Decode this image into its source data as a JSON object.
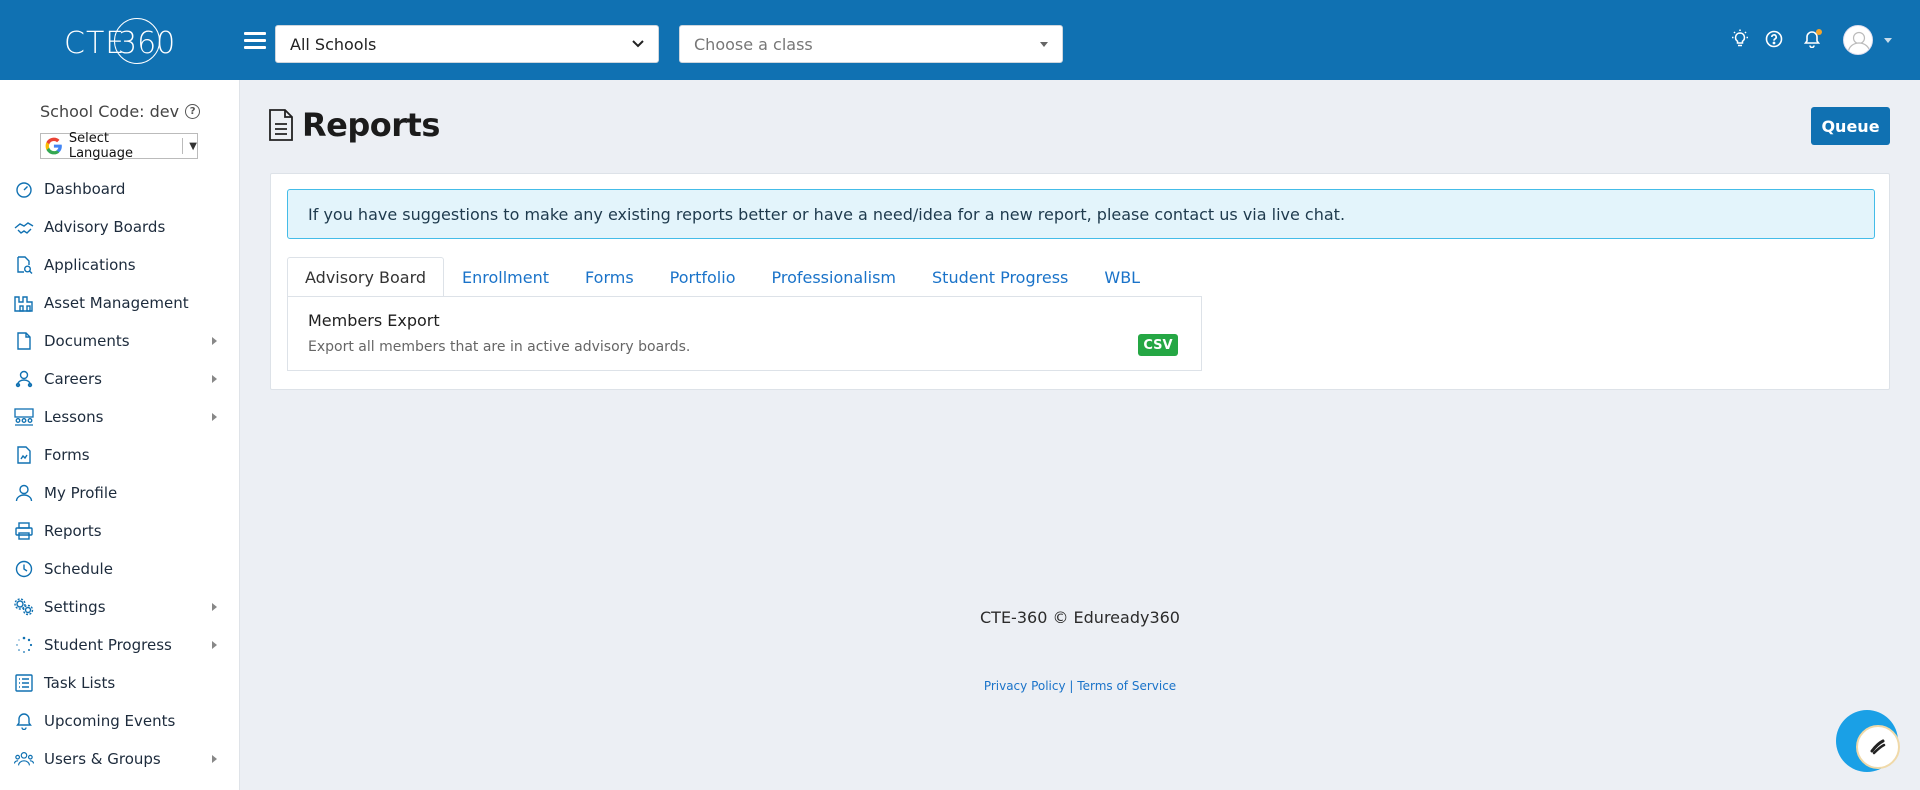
{
  "header": {
    "logo_text": "CTE",
    "logo_num": "360",
    "school_select_value": "All Schools",
    "class_select_placeholder": "Choose a class"
  },
  "sidebar": {
    "school_code": "School Code: dev",
    "language_label": "Select Language",
    "items": [
      {
        "label": "Dashboard",
        "icon": "gauge-icon",
        "submenu": false
      },
      {
        "label": "Advisory Boards",
        "icon": "handshake-icon",
        "submenu": false
      },
      {
        "label": "Applications",
        "icon": "document-search-icon",
        "submenu": false
      },
      {
        "label": "Asset Management",
        "icon": "warehouse-icon",
        "submenu": false
      },
      {
        "label": "Documents",
        "icon": "file-icon",
        "submenu": true
      },
      {
        "label": "Careers",
        "icon": "career-icon",
        "submenu": true
      },
      {
        "label": "Lessons",
        "icon": "classroom-icon",
        "submenu": true
      },
      {
        "label": "Forms",
        "icon": "form-icon",
        "submenu": false
      },
      {
        "label": "My Profile",
        "icon": "user-icon",
        "submenu": false
      },
      {
        "label": "Reports",
        "icon": "printer-icon",
        "submenu": false
      },
      {
        "label": "Schedule",
        "icon": "clock-icon",
        "submenu": false
      },
      {
        "label": "Settings",
        "icon": "gears-icon",
        "submenu": true
      },
      {
        "label": "Student Progress",
        "icon": "spinner-icon",
        "submenu": true
      },
      {
        "label": "Task Lists",
        "icon": "list-icon",
        "submenu": false
      },
      {
        "label": "Upcoming Events",
        "icon": "bell-icon",
        "submenu": false
      },
      {
        "label": "Users & Groups",
        "icon": "users-icon",
        "submenu": true
      }
    ]
  },
  "main": {
    "title": "Reports",
    "queue_label": "Queue",
    "alert_text": "If you have suggestions to make any existing reports better or have a need/idea for a new report, please contact us via live chat.",
    "tabs": [
      "Advisory Board",
      "Enrollment",
      "Forms",
      "Portfolio",
      "Professionalism",
      "Student Progress",
      "WBL"
    ],
    "active_tab": "Advisory Board",
    "report": {
      "title": "Members Export",
      "description": "Export all members that are in active advisory boards.",
      "format": "CSV"
    }
  },
  "footer": {
    "copyright": "CTE-360 © Eduready360",
    "privacy": "Privacy Policy",
    "separator": "|",
    "terms": "Terms of Service"
  },
  "colors": {
    "brand": "#1071b2",
    "link": "#1a73c9",
    "success": "#25a744",
    "alert_border": "#44bce8"
  }
}
